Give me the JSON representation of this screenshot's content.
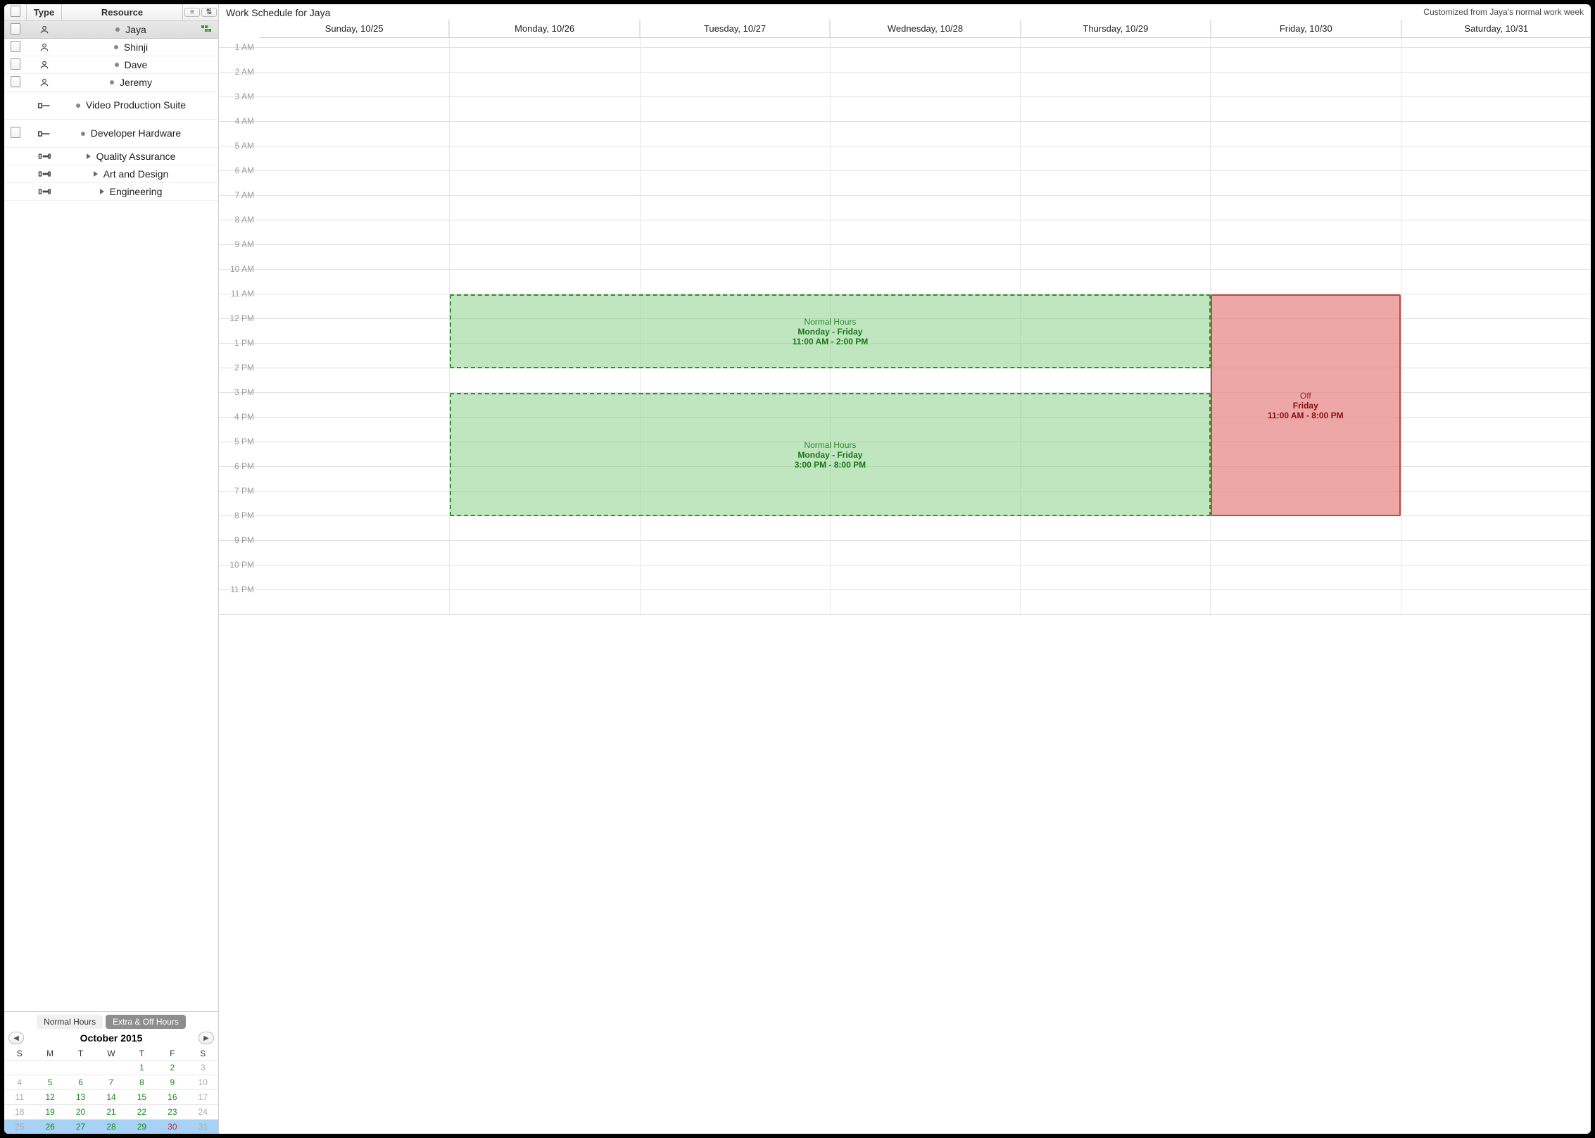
{
  "sidebar_header": {
    "notes": "",
    "type": "Type",
    "resource": "Resource"
  },
  "resources": [
    {
      "name": "Jaya",
      "kind": "person",
      "hasNote": true,
      "bullet": "dot",
      "selected": true,
      "badge": true
    },
    {
      "name": "Shinji",
      "kind": "person",
      "hasNote": true,
      "bullet": "dot"
    },
    {
      "name": "Dave",
      "kind": "person",
      "hasNote": true,
      "bullet": "dot"
    },
    {
      "name": "Jeremy",
      "kind": "person",
      "hasNote": true,
      "bullet": "dot"
    },
    {
      "name": "Video Production Suite",
      "kind": "tool",
      "hasNote": false,
      "bullet": "dot",
      "tall": true
    },
    {
      "name": "Developer Hardware",
      "kind": "tool",
      "hasNote": true,
      "bullet": "dot",
      "tall": true
    },
    {
      "name": "Quality Assurance",
      "kind": "group",
      "hasNote": false,
      "bullet": "tri"
    },
    {
      "name": "Art and Design",
      "kind": "group",
      "hasNote": false,
      "bullet": "tri"
    },
    {
      "name": "Engineering",
      "kind": "group",
      "hasNote": false,
      "bullet": "tri"
    }
  ],
  "tabs": {
    "normal": "Normal Hours",
    "extra": "Extra & Off Hours",
    "active": "extra"
  },
  "calendar": {
    "title": "October 2015",
    "dow": [
      "S",
      "M",
      "T",
      "W",
      "T",
      "F",
      "S"
    ],
    "rows": [
      [
        {
          "n": "",
          "cls": ""
        },
        {
          "n": "",
          "cls": ""
        },
        {
          "n": "",
          "cls": ""
        },
        {
          "n": "",
          "cls": ""
        },
        {
          "n": "1",
          "cls": "green"
        },
        {
          "n": "2",
          "cls": "green"
        },
        {
          "n": "3",
          "cls": "dim"
        }
      ],
      [
        {
          "n": "4",
          "cls": "dim"
        },
        {
          "n": "5",
          "cls": "green"
        },
        {
          "n": "6",
          "cls": "green"
        },
        {
          "n": "7",
          "cls": "green"
        },
        {
          "n": "8",
          "cls": "green"
        },
        {
          "n": "9",
          "cls": "green"
        },
        {
          "n": "10",
          "cls": "dim"
        }
      ],
      [
        {
          "n": "11",
          "cls": "dim"
        },
        {
          "n": "12",
          "cls": "green"
        },
        {
          "n": "13",
          "cls": "green"
        },
        {
          "n": "14",
          "cls": "green"
        },
        {
          "n": "15",
          "cls": "green"
        },
        {
          "n": "16",
          "cls": "green"
        },
        {
          "n": "17",
          "cls": "dim"
        }
      ],
      [
        {
          "n": "18",
          "cls": "dim"
        },
        {
          "n": "19",
          "cls": "green"
        },
        {
          "n": "20",
          "cls": "green"
        },
        {
          "n": "21",
          "cls": "green"
        },
        {
          "n": "22",
          "cls": "green"
        },
        {
          "n": "23",
          "cls": "green"
        },
        {
          "n": "24",
          "cls": "dim"
        }
      ],
      [
        {
          "n": "25",
          "cls": "dim hl"
        },
        {
          "n": "26",
          "cls": "green hl"
        },
        {
          "n": "27",
          "cls": "green hl"
        },
        {
          "n": "28",
          "cls": "green hl"
        },
        {
          "n": "29",
          "cls": "green hl"
        },
        {
          "n": "30",
          "cls": "red hl"
        },
        {
          "n": "31",
          "cls": "dim hl"
        }
      ]
    ]
  },
  "schedule": {
    "title": "Work Schedule for Jaya",
    "subtitle": "Customized from Jaya's normal work week",
    "days": [
      "Sunday, 10/25",
      "Monday, 10/26",
      "Tuesday, 10/27",
      "Wednesday, 10/28",
      "Thursday, 10/29",
      "Friday, 10/30",
      "Saturday, 10/31"
    ],
    "hours": [
      "1 AM",
      "2 AM",
      "3 AM",
      "4 AM",
      "5 AM",
      "6 AM",
      "7 AM",
      "8 AM",
      "9 AM",
      "10 AM",
      "11 AM",
      "12 PM",
      "1 PM",
      "2 PM",
      "3 PM",
      "4 PM",
      "5 PM",
      "6 PM",
      "7 PM",
      "8 PM",
      "9 PM",
      "10 PM",
      "11 PM"
    ],
    "blocks": [
      {
        "type": "green",
        "dayStart": 1,
        "daySpan": 4,
        "hourStart": 11,
        "hourSpan": 3,
        "title": "Normal Hours",
        "bold1": "Monday - Friday",
        "bold2": "11:00 AM - 2:00 PM"
      },
      {
        "type": "green",
        "dayStart": 1,
        "daySpan": 4,
        "hourStart": 15,
        "hourSpan": 5,
        "title": "Normal Hours",
        "bold1": "Monday - Friday",
        "bold2": "3:00 PM - 8:00 PM"
      },
      {
        "type": "red",
        "dayStart": 5,
        "daySpan": 1,
        "hourStart": 11,
        "hourSpan": 9,
        "title": "Off",
        "bold1": "Friday",
        "bold2": "11:00 AM - 8:00 PM"
      }
    ]
  }
}
